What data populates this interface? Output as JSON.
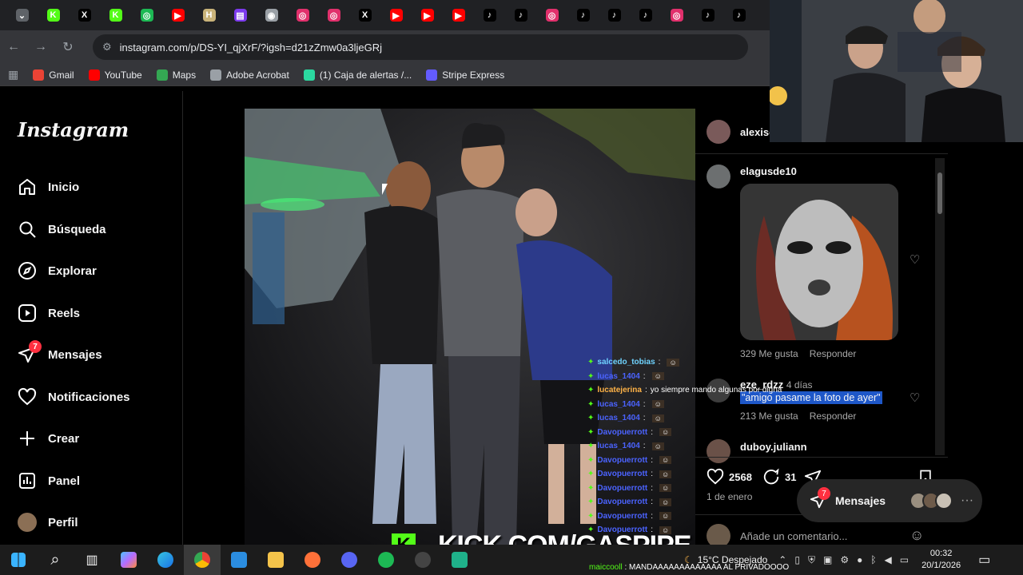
{
  "browser": {
    "tabs": [
      {
        "icon": "tab-favicon-dropdown",
        "color": "#5f6368",
        "glyph": "⌄"
      },
      {
        "icon": "kick-icon",
        "color": "#53fc18",
        "glyph": "K"
      },
      {
        "icon": "x-icon",
        "color": "#000000",
        "glyph": "X"
      },
      {
        "icon": "kick-icon",
        "color": "#53fc18",
        "glyph": "K"
      },
      {
        "icon": "circle-icon",
        "color": "#1db954",
        "glyph": "◎"
      },
      {
        "icon": "youtube-icon",
        "color": "#ff0000",
        "glyph": "▶"
      },
      {
        "icon": "h-icon",
        "color": "#c9b37a",
        "glyph": "H"
      },
      {
        "icon": "chat-icon",
        "color": "#7c3aed",
        "glyph": "▤"
      },
      {
        "icon": "chrome-icon",
        "color": "#9aa0a6",
        "glyph": "◉"
      },
      {
        "icon": "instagram-icon",
        "color": "#e1306c",
        "glyph": "◎"
      },
      {
        "icon": "instagram-icon",
        "color": "#e1306c",
        "glyph": "◎"
      },
      {
        "icon": "x-icon",
        "color": "#000000",
        "glyph": "X"
      },
      {
        "icon": "youtube-icon",
        "color": "#ff0000",
        "glyph": "▶"
      },
      {
        "icon": "youtube-icon",
        "color": "#ff0000",
        "glyph": "▶"
      },
      {
        "icon": "youtube-icon",
        "color": "#ff0000",
        "glyph": "▶"
      },
      {
        "icon": "tiktok-icon",
        "color": "#000000",
        "glyph": "♪"
      },
      {
        "icon": "tiktok-icon",
        "color": "#000000",
        "glyph": "♪"
      },
      {
        "icon": "instagram-icon",
        "color": "#e1306c",
        "glyph": "◎"
      },
      {
        "icon": "tiktok-icon",
        "color": "#000000",
        "glyph": "♪"
      },
      {
        "icon": "tiktok-icon",
        "color": "#000000",
        "glyph": "♪"
      },
      {
        "icon": "tiktok-icon",
        "color": "#000000",
        "glyph": "♪"
      },
      {
        "icon": "instagram-icon",
        "color": "#e1306c",
        "glyph": "◎"
      },
      {
        "icon": "tiktok-icon",
        "color": "#000000",
        "glyph": "♪"
      },
      {
        "icon": "tiktok-icon",
        "color": "#000000",
        "glyph": "♪"
      }
    ],
    "url": "instagram.com/p/DS-YI_qjXrF/?igsh=d21zZmw0a3ljeGRj",
    "bookmarks": [
      {
        "label": "Gmail",
        "color": "#ea4335"
      },
      {
        "label": "YouTube",
        "color": "#ff0000"
      },
      {
        "label": "Maps",
        "color": "#34a853"
      },
      {
        "label": "Adobe Acrobat",
        "color": "#9aa0a6"
      },
      {
        "label": "(1) Caja de alertas /...",
        "color": "#2bd9a0"
      },
      {
        "label": "Stripe Express",
        "color": "#635bff"
      }
    ]
  },
  "instagram": {
    "logo": "Instagram",
    "nav": {
      "inicio": "Inicio",
      "busqueda": "Búsqueda",
      "explorar": "Explorar",
      "reels": "Reels",
      "mensajes": "Mensajes",
      "mensajes_badge": "7",
      "notificaciones": "Notificaciones",
      "crear": "Crear",
      "panel": "Panel",
      "perfil": "Perfil"
    },
    "post": {
      "author": "alexisc",
      "comments": [
        {
          "user": "elagusde10",
          "likes": "329 Me gusta",
          "reply": "Responder"
        },
        {
          "user": "eze_rdzz",
          "time": "4 días",
          "text": "\"amigo pasame la foto de ayer\"",
          "likes": "213 Me gusta",
          "reply": "Responder"
        },
        {
          "user": "duboy.juliann"
        }
      ],
      "like_count": "2568",
      "comment_count": "31",
      "date": "1 de enero",
      "comment_placeholder": "Añade un comentario..."
    },
    "messages_pill": {
      "label": "Mensajes",
      "badge": "7"
    }
  },
  "stream": {
    "kick_url": "KICK.COM/GASPIPE",
    "chat": [
      {
        "user": "salcedo_tobias",
        "color": "#6fd3ff",
        "msg": ""
      },
      {
        "user": "lucas_1404",
        "color": "#4b63ff",
        "msg": ""
      },
      {
        "user": "lucatejerina",
        "color": "#ffb347",
        "msg": "yo siempre mando algunas por digna"
      },
      {
        "user": "lucas_1404",
        "color": "#4b63ff",
        "msg": ""
      },
      {
        "user": "lucas_1404",
        "color": "#4b63ff",
        "msg": ""
      },
      {
        "user": "Davopuerrott",
        "color": "#4b63ff",
        "msg": ""
      },
      {
        "user": "lucas_1404",
        "color": "#4b63ff",
        "msg": ""
      },
      {
        "user": "Davopuerrott",
        "color": "#4b63ff",
        "msg": ""
      },
      {
        "user": "Davopuerrott",
        "color": "#4b63ff",
        "msg": ""
      },
      {
        "user": "Davopuerrott",
        "color": "#4b63ff",
        "msg": ""
      },
      {
        "user": "Davopuerrott",
        "color": "#4b63ff",
        "msg": ""
      },
      {
        "user": "Davopuerrott",
        "color": "#4b63ff",
        "msg": ""
      },
      {
        "user": "Davopuerrott",
        "color": "#4b63ff",
        "msg": ""
      }
    ],
    "bottom_chat": {
      "user": "maiccooll",
      "msg": "MANDAAAAAAAAAAAAA AL PRIVADOOOO"
    }
  },
  "taskbar": {
    "weather": "15°C  Despejado",
    "time": "00:32",
    "date": "20/1/2026"
  }
}
